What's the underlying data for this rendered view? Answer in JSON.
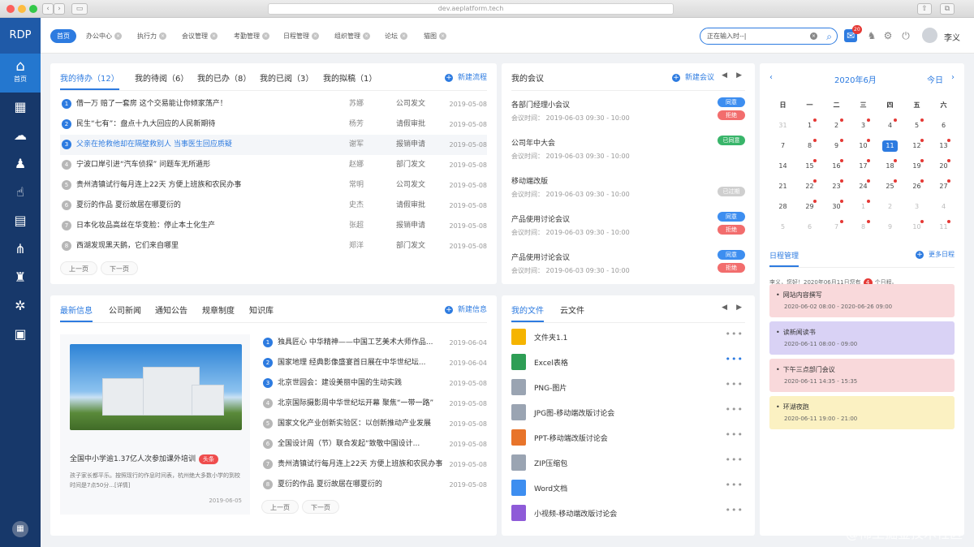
{
  "browser": {
    "url": "dev.aeplatform.tech"
  },
  "app": {
    "logo": "RDP",
    "user_name": "李义",
    "notification_count": "20",
    "watermark": "@稀土掘金技术社区"
  },
  "sidebar": {
    "home_label": "首页",
    "home_icon": "⌂"
  },
  "tabs": [
    "首页",
    "办公中心",
    "执行力",
    "会议管理",
    "考勤管理",
    "日程管理",
    "组织管理",
    "论坛",
    "猫图"
  ],
  "search": {
    "placeholder": "正在输入时--|"
  },
  "todo": {
    "tabs": [
      "我的待办（12）",
      "我的待阅（6）",
      "我的已办（8）",
      "我的已阅（3）",
      "我的拟稿（1）"
    ],
    "new_label": "新建流程",
    "rows": [
      {
        "n": "1",
        "title": "借一万 赔了一套房 这个交易能让你倾家荡产！",
        "person": "苏娜",
        "type": "公司发文",
        "date": "2019-05-08"
      },
      {
        "n": "2",
        "title": "民生“七有”：盘点十九大回应的人民新期待",
        "person": "杨芳",
        "type": "请假审批",
        "date": "2019-05-08"
      },
      {
        "n": "3",
        "title": "父亲在抢救他却在隔壁救别人 当事医生回应质疑",
        "person": "谢军",
        "type": "报销申请",
        "date": "2019-05-08"
      },
      {
        "n": "4",
        "title": "宁波口岸引进“汽车侦探” 问题车无所遁形",
        "person": "赵娜",
        "type": "部门发文",
        "date": "2019-05-08"
      },
      {
        "n": "5",
        "title": "贵州清镇试行每月连上22天 方便上班族和农民办事",
        "person": "常明",
        "type": "公司发文",
        "date": "2019-05-08"
      },
      {
        "n": "6",
        "title": "夏衍的作品 夏衍故居在哪夏衍的",
        "person": "史杰",
        "type": "请假审批",
        "date": "2019-05-08"
      },
      {
        "n": "7",
        "title": "日本化妆品高丝在华变脸：停止本土化生产",
        "person": "张超",
        "type": "报销申请",
        "date": "2019-05-08"
      },
      {
        "n": "8",
        "title": "西湖发现黑天鹅，它们来自哪里",
        "person": "郑洋",
        "type": "部门发文",
        "date": "2019-05-08"
      }
    ],
    "prev": "上一页",
    "next": "下一页"
  },
  "meetings": {
    "title": "我的会议",
    "new_label": "新建会议",
    "time_label": "会议时间：",
    "rows": [
      {
        "title": "各部门经理小会议",
        "date": "2019-06-03",
        "time": "09:30 - 10:00",
        "badges": [
          "同意",
          "拒绝"
        ]
      },
      {
        "title": "公司年中大会",
        "date": "2019-06-03",
        "time": "09:30 - 10:00",
        "badges": [
          "已同意"
        ]
      },
      {
        "title": "移动端改版",
        "date": "2019-06-03",
        "time": "09:30 - 10:00",
        "badges": [
          "已过期"
        ]
      },
      {
        "title": "产品使用讨论会议",
        "date": "2019-06-03",
        "time": "09:30 - 10:00",
        "badges": [
          "同意",
          "拒绝"
        ]
      },
      {
        "title": "产品使用讨论会议",
        "date": "2019-06-03",
        "time": "09:30 - 10:00",
        "badges": [
          "同意",
          "拒绝"
        ]
      }
    ]
  },
  "calendar": {
    "month_label": "2020年6月",
    "today_label": "今日",
    "weekdays": [
      "日",
      "一",
      "二",
      "三",
      "四",
      "五",
      "六"
    ],
    "weeks": [
      [
        "31",
        "1",
        "2",
        "3",
        "4",
        "5",
        "6"
      ],
      [
        "7",
        "8",
        "9",
        "10",
        "11",
        "12",
        "13"
      ],
      [
        "14",
        "15",
        "16",
        "17",
        "18",
        "19",
        "20"
      ],
      [
        "21",
        "22",
        "23",
        "24",
        "25",
        "26",
        "27"
      ],
      [
        "28",
        "29",
        "30",
        "1",
        "2",
        "3",
        "4"
      ],
      [
        "5",
        "6",
        "7",
        "8",
        "9",
        "10",
        "11"
      ]
    ],
    "today": "11"
  },
  "schedule": {
    "title": "日程管理",
    "more_label": "更多日程",
    "greeting_pre": "李义，您好！2020年06月11日您有",
    "count": "4",
    "greeting_post": "个日程。",
    "items": [
      {
        "title": "网站内容撰写",
        "date": "2020-06-02 08:00 - 2020-06-26 09:00",
        "color": "#f9d9db"
      },
      {
        "title": "读新闻读书",
        "date": "2020-06-11 08:00 - 09:00",
        "color": "#d9d2f5"
      },
      {
        "title": "下午三点部门会议",
        "date": "2020-06-11 14:35 - 15:35",
        "color": "#f9d9db"
      },
      {
        "title": "环湖夜跑",
        "date": "2020-06-11 19:00 - 21:00",
        "color": "#fbf1c2"
      }
    ]
  },
  "news": {
    "tabs": [
      "最新信息",
      "公司新闻",
      "通知公告",
      "规章制度",
      "知识库"
    ],
    "new_label": "新建信息",
    "featured": {
      "title": "全国中小学逾1.37亿人次参加课外培训",
      "tag": "头条",
      "desc": "孩子家长都平乐。按照现行的作息时间表，杭州绝大多数小学的到校时间是7点50分...[详情]",
      "date": "2019-06-05"
    },
    "rows": [
      {
        "n": "1",
        "title": "独具匠心 中华精神——中国工艺美术大师作品...",
        "date": "2019-06-04"
      },
      {
        "n": "2",
        "title": "国家地理 经典影像盛宴首日展在中华世纪坛...",
        "date": "2019-06-04"
      },
      {
        "n": "3",
        "title": "北京世园会：建设美丽中国的生动实践",
        "date": "2019-05-08"
      },
      {
        "n": "4",
        "title": "北京国际摄影周中华世纪坛开幕 聚焦“一带一路”",
        "date": "2019-05-08"
      },
      {
        "n": "5",
        "title": "国家文化产业创新实验区：以创新推动产业发展",
        "date": "2019-05-08"
      },
      {
        "n": "6",
        "title": "全国设计周（节）联合发起“致敬中国设计...",
        "date": "2019-05-08"
      },
      {
        "n": "7",
        "title": "贵州清镇试行每月连上22天 方便上班族和农民办事",
        "date": "2019-05-08"
      },
      {
        "n": "8",
        "title": "夏衍的作品 夏衍故居在哪夏衍的",
        "date": "2019-05-08"
      }
    ],
    "prev": "上一页",
    "next": "下一页"
  },
  "files": {
    "tabs": [
      "我的文件",
      "云文件"
    ],
    "items": [
      {
        "name": "文件夹1.1",
        "icon": "folder-icon",
        "color": "#f5b400"
      },
      {
        "name": "Excel表格",
        "icon": "excel-icon",
        "color": "#2e9e55"
      },
      {
        "name": "PNG-图片",
        "icon": "png-icon",
        "color": "#9aa4b2"
      },
      {
        "name": "JPG图-移动端改版讨论会",
        "icon": "jpg-icon",
        "color": "#9aa4b2"
      },
      {
        "name": "PPT-移动端改版讨论会",
        "icon": "ppt-icon",
        "color": "#e8742a"
      },
      {
        "name": "ZIP压缩包",
        "icon": "zip-icon",
        "color": "#9aa4b2"
      },
      {
        "name": "Word文档",
        "icon": "word-icon",
        "color": "#3d8ef0"
      },
      {
        "name": "小视频-移动端改版讨论会",
        "icon": "video-icon",
        "color": "#8e5bd8"
      }
    ]
  }
}
